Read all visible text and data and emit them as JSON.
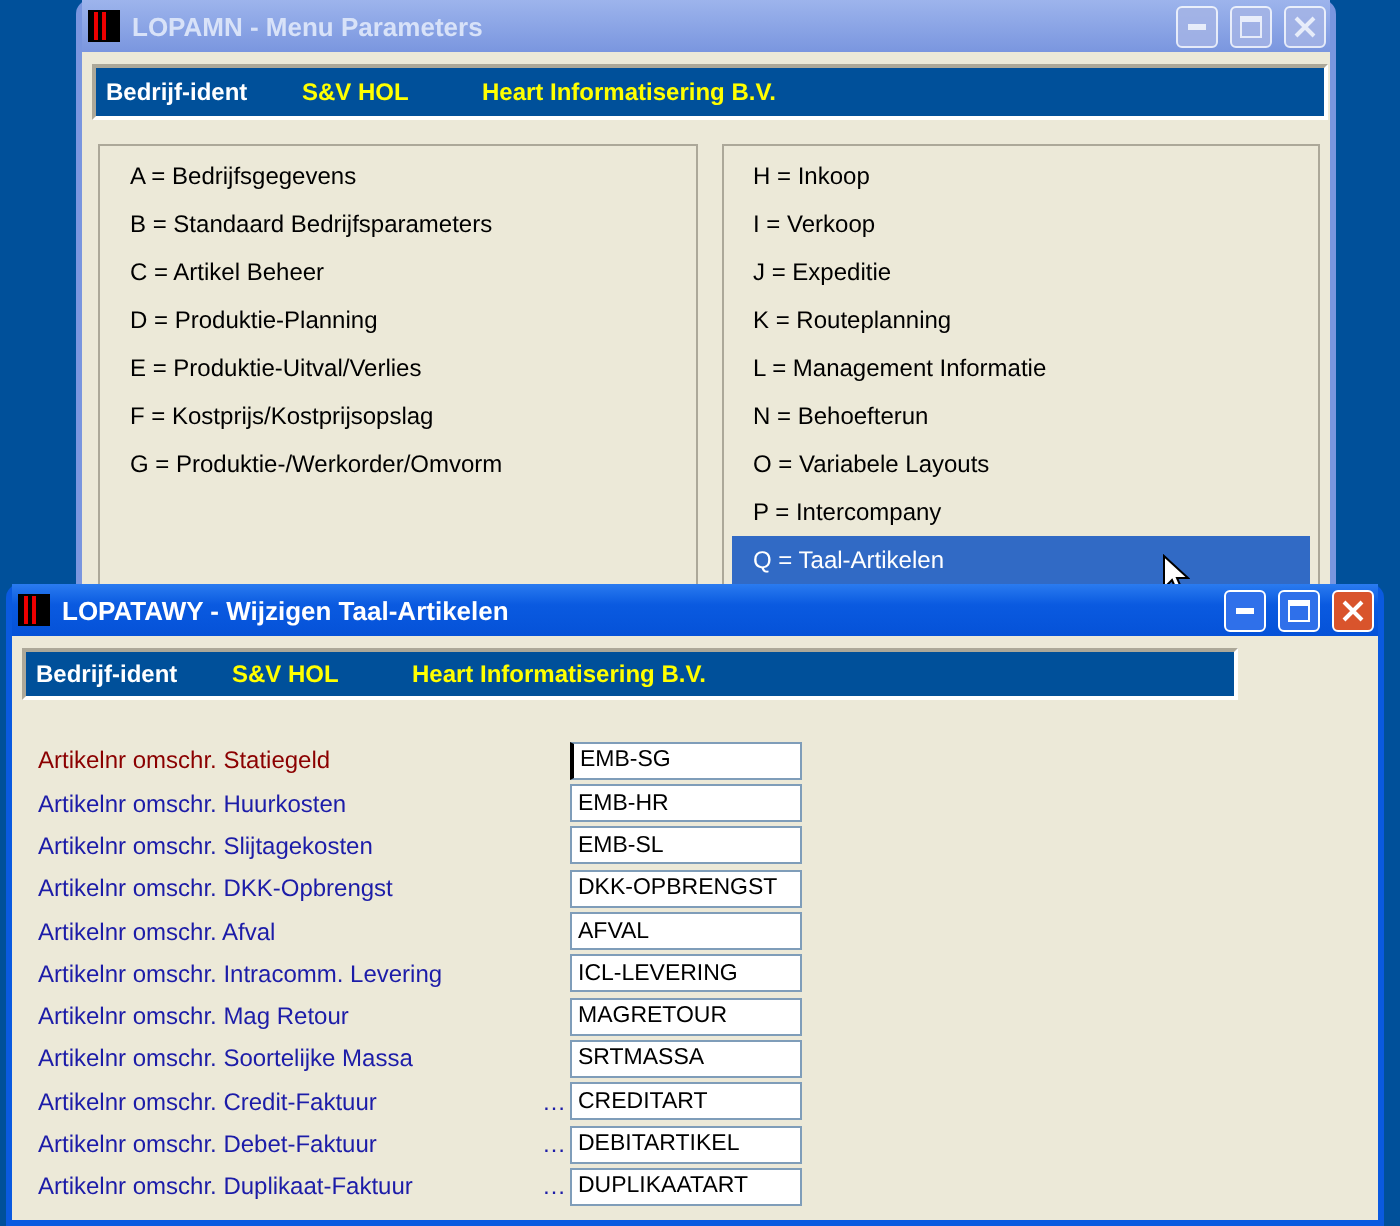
{
  "back_window": {
    "title": "LOPAMN - Menu Parameters",
    "active": false,
    "ident": {
      "label": "Bedrijf-ident",
      "code": "S&V HOL",
      "company": "Heart Informatisering B.V."
    },
    "menu_left": [
      {
        "label": "A = Bedrijfsgegevens",
        "selected": false
      },
      {
        "label": "B = Standaard Bedrijfsparameters",
        "selected": false
      },
      {
        "label": "C = Artikel Beheer",
        "selected": false
      },
      {
        "label": "D = Produktie-Planning",
        "selected": false
      },
      {
        "label": "E = Produktie-Uitval/Verlies",
        "selected": false
      },
      {
        "label": "F = Kostprijs/Kostprijsopslag",
        "selected": false
      },
      {
        "label": "G = Produktie-/Werkorder/Omvorm",
        "selected": false
      }
    ],
    "menu_right": [
      {
        "label": "H = Inkoop",
        "selected": false
      },
      {
        "label": "I = Verkoop",
        "selected": false
      },
      {
        "label": "J = Expeditie",
        "selected": false
      },
      {
        "label": "K = Routeplanning",
        "selected": false
      },
      {
        "label": "L = Management Informatie",
        "selected": false
      },
      {
        "label": "N = Behoefterun",
        "selected": false
      },
      {
        "label": "O = Variabele Layouts",
        "selected": false
      },
      {
        "label": "P = Intercompany",
        "selected": false
      },
      {
        "label": "Q = Taal-Artikelen",
        "selected": true
      }
    ]
  },
  "front_window": {
    "title": "LOPATAWY - Wijzigen Taal-Artikelen",
    "active": true,
    "ident": {
      "label": "Bedrijf-ident",
      "code": "S&V HOL",
      "company": "Heart Informatisering B.V."
    },
    "rows": [
      {
        "label": "Artikelnr omschr. Statiegeld",
        "value": "EMB-SG",
        "focused": true
      },
      {
        "label": "Artikelnr omschr. Huurkosten",
        "value": "EMB-HR",
        "focused": false
      },
      {
        "label": "Artikelnr omschr. Slijtagekosten",
        "value": "EMB-SL",
        "focused": false
      },
      {
        "label": "Artikelnr omschr. DKK-Opbrengst",
        "value": "DKK-OPBRENGST",
        "focused": false
      },
      {
        "label": "Artikelnr omschr. Afval",
        "value": "AFVAL",
        "focused": false
      },
      {
        "label": "Artikelnr omschr. Intracomm. Levering",
        "value": "ICL-LEVERING",
        "focused": false
      },
      {
        "label": "Artikelnr omschr. Mag Retour",
        "value": "MAGRETOUR",
        "focused": false
      },
      {
        "label": "Artikelnr omschr. Soortelijke Massa",
        "value": "SRTMASSA",
        "focused": false
      },
      {
        "label": "Artikelnr omschr. Credit-Faktuur",
        "value": "CREDITART",
        "focused": false,
        "lookup": "…"
      },
      {
        "label": "Artikelnr omschr. Debet-Faktuur",
        "value": "DEBITARTIKEL",
        "focused": false,
        "lookup": "…"
      },
      {
        "label": "Artikelnr omschr. Duplikaat-Faktuur",
        "value": "DUPLIKAATART",
        "focused": false,
        "lookup": "…"
      }
    ]
  }
}
